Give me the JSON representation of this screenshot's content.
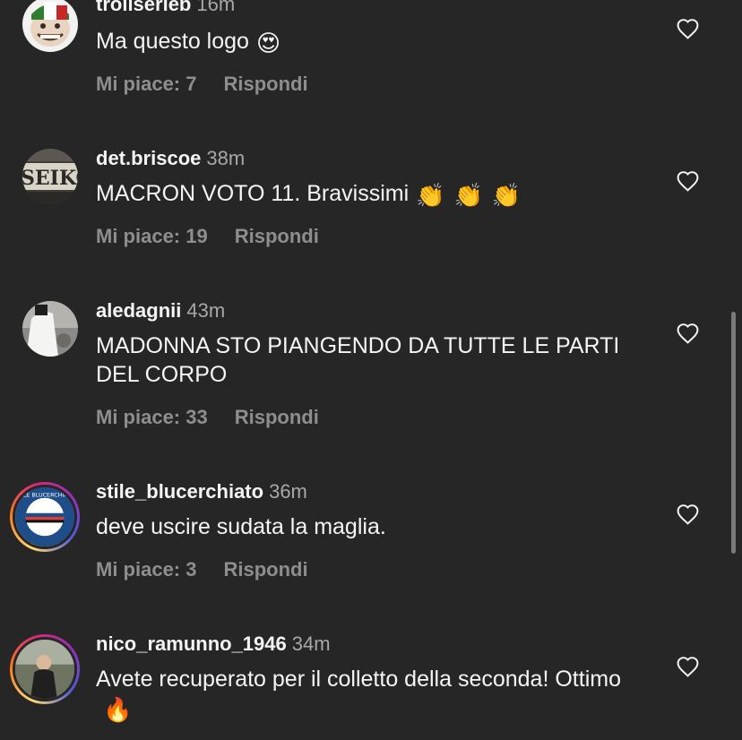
{
  "comments": [
    {
      "username": "trollserieb",
      "time": "16m",
      "text": "Ma questo logo",
      "emoji": [
        "😍"
      ],
      "likes": "Mi piace: 7",
      "reply": "Rispondi"
    },
    {
      "username": "det.briscoe",
      "time": "38m",
      "text": "MACRON VOTO 11. Bravissimi",
      "emoji": [
        "👏",
        "👏",
        "👏"
      ],
      "likes": "Mi piace: 19",
      "reply": "Rispondi",
      "avatar_text": "SEIKO"
    },
    {
      "username": "aledagnii",
      "time": "43m",
      "text": "MADONNA STO PIANGENDO DA TUTTE LE PARTI DEL CORPO",
      "emoji": [],
      "likes": "Mi piace: 33",
      "reply": "Rispondi"
    },
    {
      "username": "stile_blucerchiato",
      "time": "36m",
      "text": "deve uscire sudata la maglia.",
      "emoji": [],
      "likes": "Mi piace: 3",
      "reply": "Rispondi",
      "avatar_text": "STILE BLUCERCHIATO"
    },
    {
      "username": "nico_ramunno_1946",
      "time": "34m",
      "text": "Avete recuperato per il colletto della seconda! Ottimo",
      "emoji": [
        "🔥"
      ]
    }
  ],
  "icons": {
    "like": "heart-outline-icon"
  },
  "colors": {
    "background": "#262626",
    "text": "#f5f5f5",
    "secondary_text": "#8e8e8e"
  }
}
